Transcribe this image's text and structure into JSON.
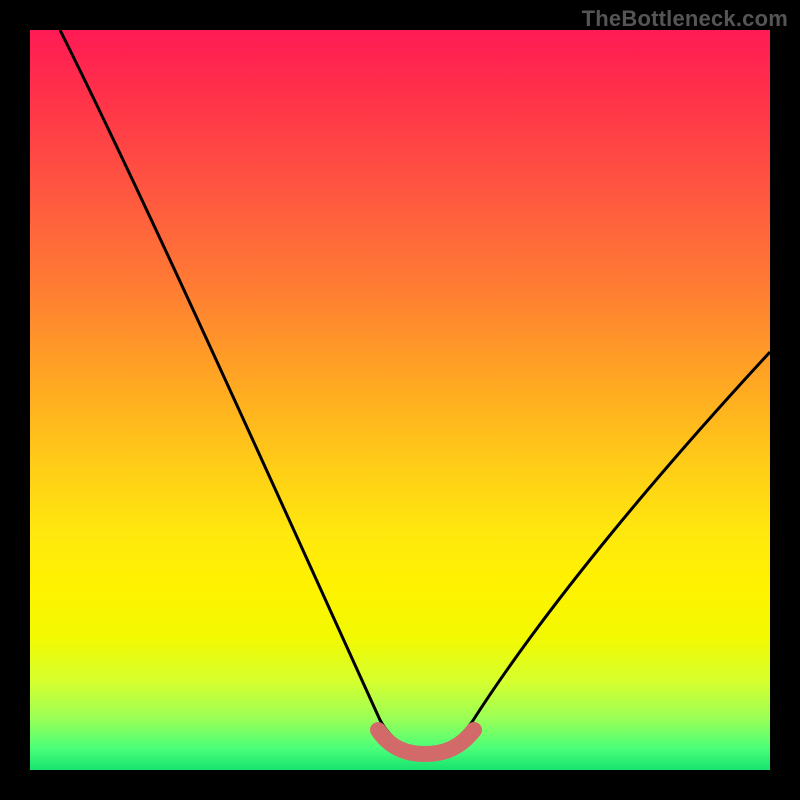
{
  "watermark": "TheBottleneck.com",
  "chart_data": {
    "type": "line",
    "title": "",
    "xlabel": "",
    "ylabel": "",
    "x": [
      0.0,
      0.05,
      0.1,
      0.15,
      0.2,
      0.25,
      0.3,
      0.35,
      0.4,
      0.45,
      0.48,
      0.5,
      0.53,
      0.56,
      0.6,
      0.65,
      0.7,
      0.75,
      0.8,
      0.85,
      0.9,
      0.95,
      1.0
    ],
    "series": [
      {
        "name": "bottleneck-curve",
        "values": [
          1.0,
          0.9,
          0.8,
          0.7,
          0.6,
          0.5,
          0.4,
          0.3,
          0.2,
          0.1,
          0.04,
          0.02,
          0.02,
          0.04,
          0.1,
          0.18,
          0.25,
          0.32,
          0.38,
          0.44,
          0.49,
          0.53,
          0.56
        ]
      },
      {
        "name": "optimal-band",
        "values": [
          null,
          null,
          null,
          null,
          null,
          null,
          null,
          null,
          null,
          null,
          0.03,
          0.02,
          0.02,
          0.03,
          null,
          null,
          null,
          null,
          null,
          null,
          null,
          null,
          null
        ]
      }
    ],
    "xlim": [
      0,
      1
    ],
    "ylim": [
      0,
      1
    ],
    "legend": false,
    "grid": false,
    "colors": {
      "curve": "#000000",
      "optimal_band": "#d36a6a",
      "gradient_top": "#ff1b55",
      "gradient_bottom": "#17e371",
      "frame": "#000000"
    }
  }
}
